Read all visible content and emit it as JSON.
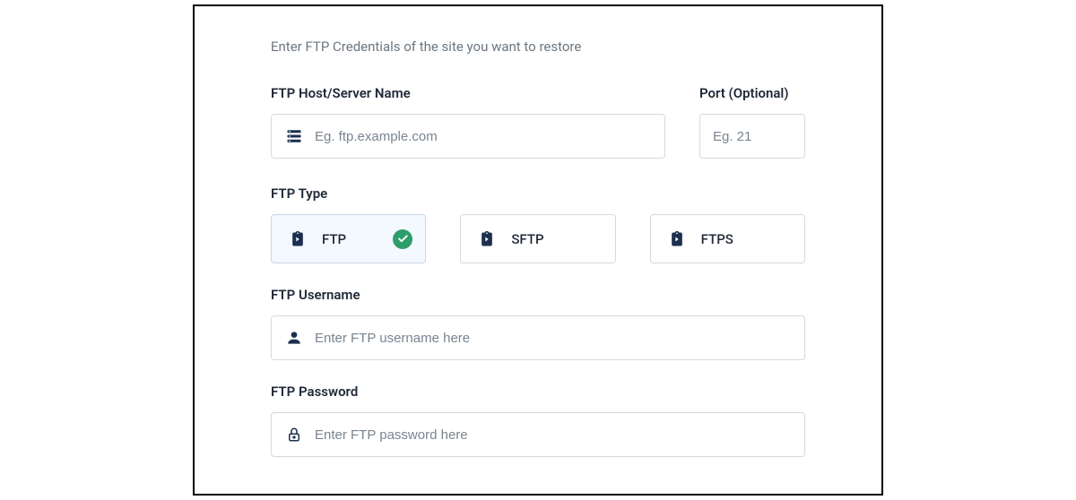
{
  "subtitle": "Enter FTP Credentials of the site you want to restore",
  "host": {
    "label": "FTP Host/Server Name",
    "placeholder": "Eg. ftp.example.com",
    "value": ""
  },
  "port": {
    "label": "Port (Optional)",
    "placeholder": "Eg. 21",
    "value": ""
  },
  "type": {
    "label": "FTP Type",
    "options": [
      {
        "label": "FTP",
        "selected": true
      },
      {
        "label": "SFTP",
        "selected": false
      },
      {
        "label": "FTPS",
        "selected": false
      }
    ]
  },
  "username": {
    "label": "FTP Username",
    "placeholder": "Enter FTP username here",
    "value": ""
  },
  "password": {
    "label": "FTP Password",
    "placeholder": "Enter FTP password here",
    "value": ""
  }
}
